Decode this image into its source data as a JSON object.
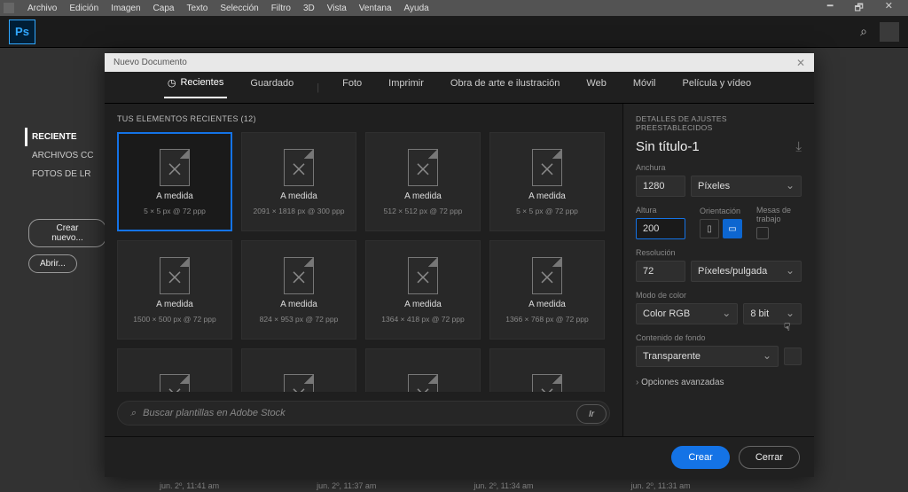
{
  "menu": [
    "Archivo",
    "Edición",
    "Imagen",
    "Capa",
    "Texto",
    "Selección",
    "Filtro",
    "3D",
    "Vista",
    "Ventana",
    "Ayuda"
  ],
  "ps": "Ps",
  "sidebar": {
    "items": [
      "RECIENTE",
      "ARCHIVOS CC",
      "FOTOS DE LR"
    ],
    "create": "Crear nuevo...",
    "open": "Abrir..."
  },
  "timestamps": [
    "jun. 2º, 11:41 am",
    "jun. 2º, 11:37 am",
    "jun. 2º, 11:34 am",
    "jun. 2º, 11:31 am"
  ],
  "dialog": {
    "title": "Nuevo Documento",
    "tabs": {
      "recent": "Recientes",
      "saved": "Guardado",
      "photo": "Foto",
      "print": "Imprimir",
      "art": "Obra de arte e ilustración",
      "web": "Web",
      "mobile": "Móvil",
      "film": "Película y vídeo"
    },
    "presets_header": "TUS ELEMENTOS RECIENTES   (12)",
    "presets": [
      {
        "t1": "A medida",
        "t2": "5 × 5 px @ 72 ppp"
      },
      {
        "t1": "A medida",
        "t2": "2091 × 1818 px @ 300 ppp"
      },
      {
        "t1": "A medida",
        "t2": "512 × 512 px @ 72 ppp"
      },
      {
        "t1": "A medida",
        "t2": "5 × 5 px @ 72 ppp"
      },
      {
        "t1": "A medida",
        "t2": "1500 × 500 px @ 72 ppp"
      },
      {
        "t1": "A medida",
        "t2": "824 × 953 px @ 72 ppp"
      },
      {
        "t1": "A medida",
        "t2": "1364 × 418 px @ 72 ppp"
      },
      {
        "t1": "A medida",
        "t2": "1366 × 768 px @ 72 ppp"
      },
      {
        "t1": "",
        "t2": ""
      },
      {
        "t1": "",
        "t2": ""
      },
      {
        "t1": "",
        "t2": ""
      },
      {
        "t1": "",
        "t2": ""
      }
    ],
    "stock_placeholder": "Buscar plantillas en Adobe Stock",
    "go": "Ir",
    "details": {
      "hdr": "DETALLES DE AJUSTES PREESTABLECIDOS",
      "name": "Sin título-1",
      "width_lbl": "Anchura",
      "width_val": "1280",
      "width_unit": "Píxeles",
      "height_lbl": "Altura",
      "height_val": "200",
      "orient_lbl": "Orientación",
      "artboards_lbl": "Mesas de trabajo",
      "res_lbl": "Resolución",
      "res_val": "72",
      "res_unit": "Píxeles/pulgada",
      "mode_lbl": "Modo de color",
      "mode_val": "Color RGB",
      "bits": "8 bit",
      "bg_lbl": "Contenido de fondo",
      "bg_val": "Transparente",
      "adv": "Opciones avanzadas"
    },
    "create": "Crear",
    "close": "Cerrar"
  }
}
